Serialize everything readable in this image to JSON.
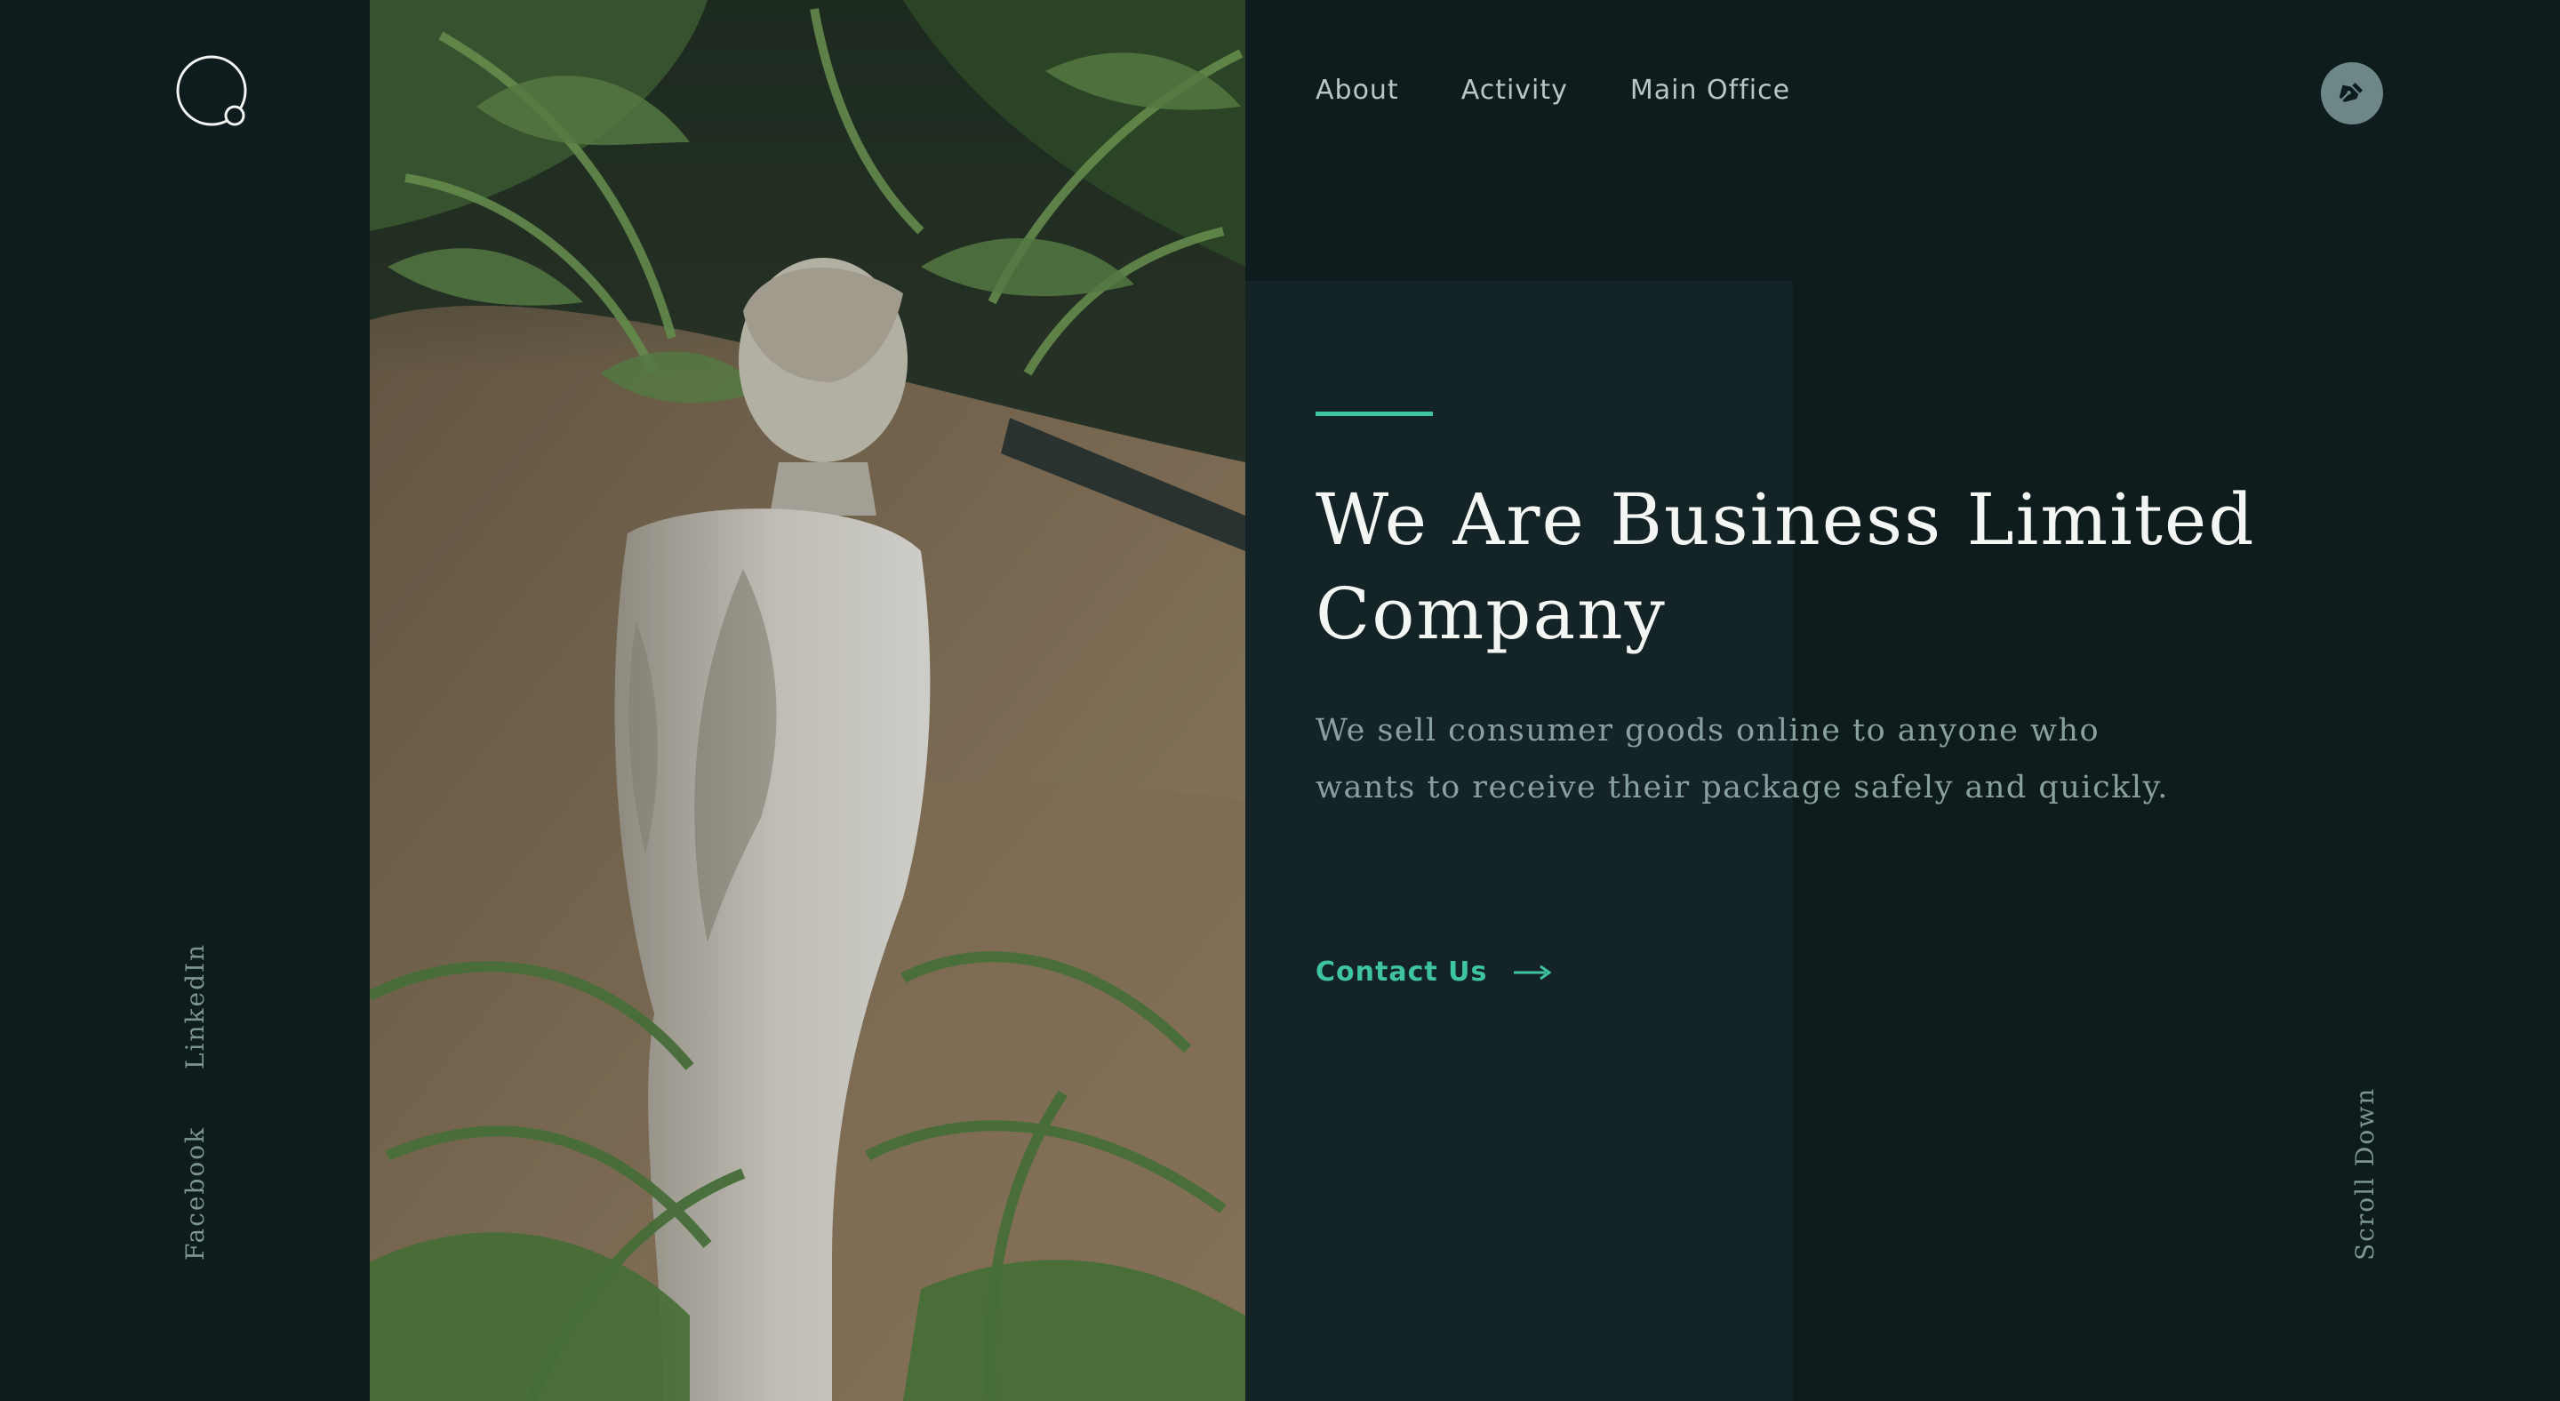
{
  "nav": {
    "items": [
      {
        "label": "About"
      },
      {
        "label": "Activity"
      },
      {
        "label": "Main Office"
      }
    ],
    "edit_icon": "pen-nib-icon"
  },
  "logo": {
    "icon": "circle-logo-icon"
  },
  "hero": {
    "headline": "We Are Business Limited Company",
    "description": "We sell consumer goods online to anyone who wants to receive their package safely and quickly.",
    "cta_label": "Contact Us",
    "cta_icon": "arrow-right-icon",
    "image_subject": "statue-among-palms-photo"
  },
  "social": {
    "linkedin_label": "LinkedIn",
    "facebook_label": "Facebook"
  },
  "scroll": {
    "label": "Scroll Down"
  },
  "colors": {
    "background": "#0e1c1e",
    "panel": "#132326",
    "accent": "#3fc4a0",
    "heading": "#f4f6f4",
    "muted": "#8aa09f",
    "icon_button": "#6d8786"
  }
}
